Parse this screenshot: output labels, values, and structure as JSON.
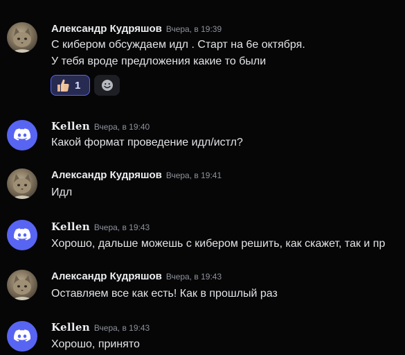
{
  "top_fragment": "...",
  "messages": [
    {
      "author": "Александр Кудряшов",
      "timestamp": "Вчера, в 19:39",
      "avatar": "cat-photo-avatar",
      "lines": [
        "С кибером обсуждаем идл . Старт на 6е октября.",
        "У тебя вроде предложения какие то были"
      ],
      "reactions": [
        {
          "emoji": "thumbs-up-icon",
          "count": "1"
        }
      ],
      "add_reaction_icon": "add-reaction-smile-icon"
    },
    {
      "author": "Kellen",
      "timestamp": "Вчера, в 19:40",
      "avatar": "discord-logo-avatar",
      "lines": [
        "Какой формат проведение идл/истл?"
      ]
    },
    {
      "author": "Александр Кудряшов",
      "timestamp": "Вчера, в 19:41",
      "avatar": "cat-photo-avatar",
      "lines": [
        "Идл"
      ]
    },
    {
      "author": "Kellen",
      "timestamp": "Вчера, в 19:43",
      "avatar": "discord-logo-avatar",
      "lines": [
        "Хорошо, дальше можешь с кибером решить, как скажет, так и пр"
      ]
    },
    {
      "author": "Александр Кудряшов",
      "timestamp": "Вчера, в 19:43",
      "avatar": "cat-photo-avatar",
      "lines": [
        "Оставляем все как есть! Как в прошлый раз"
      ]
    },
    {
      "author": "Kellen",
      "timestamp": "Вчера, в 19:43",
      "avatar": "discord-logo-avatar",
      "lines": [
        "Хорошо, принято"
      ]
    }
  ],
  "colors": {
    "background": "#060607",
    "discord_blurple": "#5865f2",
    "reaction_active_bg": "#272b52"
  }
}
